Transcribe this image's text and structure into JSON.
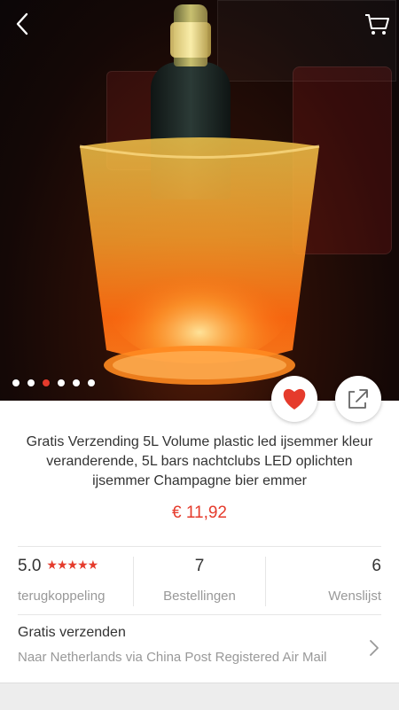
{
  "gallery": {
    "dots_total": 6,
    "active_index": 2
  },
  "icons": {
    "back": "back-arrow-icon",
    "cart": "cart-icon",
    "wishlist": "heart-icon",
    "share": "share-icon",
    "chevron": "chevron-right-icon"
  },
  "colors": {
    "accent": "#e53b2c",
    "text": "#333333",
    "muted": "#999999"
  },
  "product": {
    "title": "Gratis Verzending 5L Volume plastic led ijsemmer kleur veranderende, 5L bars nachtclubs LED oplichten ijsemmer Champagne bier emmer",
    "price": "€ 11,92"
  },
  "stats": {
    "rating_value": "5.0",
    "rating_stars": "★★★★★",
    "rating_label": "terugkoppeling",
    "orders_value": "7",
    "orders_label": "Bestellingen",
    "wishlist_value": "6",
    "wishlist_label": "Wenslijst"
  },
  "shipping": {
    "title": "Gratis verzenden",
    "subtitle": "Naar Netherlands via China Post Registered Air Mail"
  }
}
